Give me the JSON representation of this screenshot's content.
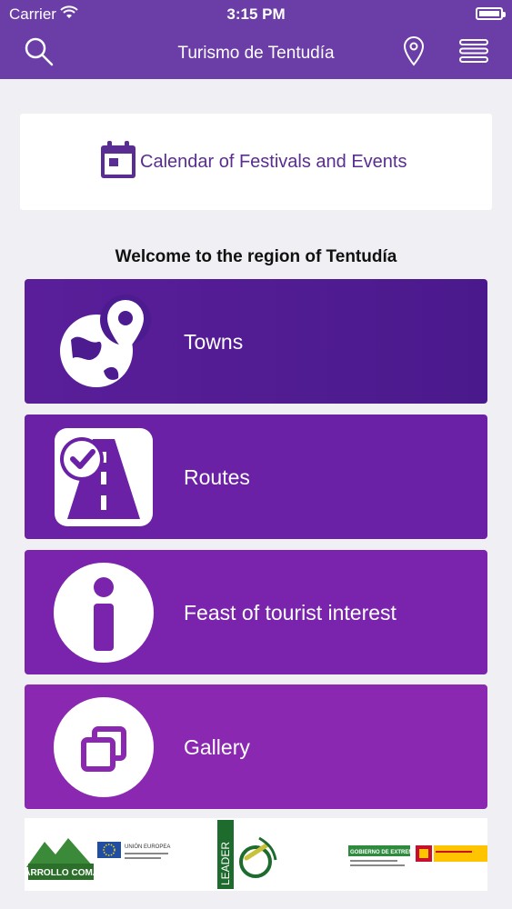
{
  "status_bar": {
    "carrier": "Carrier",
    "time": "3:15 PM"
  },
  "nav": {
    "title": "Turismo de Tentudía"
  },
  "calendar": {
    "label": "Calendar of Festivals and Events"
  },
  "welcome": "Welcome to the region of Tentudía",
  "menu": [
    {
      "label": "Towns",
      "icon": "globe-pin-icon"
    },
    {
      "label": "Routes",
      "icon": "road-check-icon"
    },
    {
      "label": "Feast of tourist interest",
      "icon": "info-icon"
    },
    {
      "label": "Gallery",
      "icon": "gallery-icon"
    }
  ],
  "footer": {
    "tentudia_logo": "CENTRO DE DESARROLLO COMARCAL TENTUDÍA",
    "eu_logo": "UNIÓN EUROPEA",
    "leader_logo": "LEADER",
    "extremadura_logo": "GOBIERNO DE EXTREMADURA"
  },
  "colors": {
    "header": "#6b3da6",
    "accent": "#5a2d92",
    "background": "#efeff4"
  }
}
